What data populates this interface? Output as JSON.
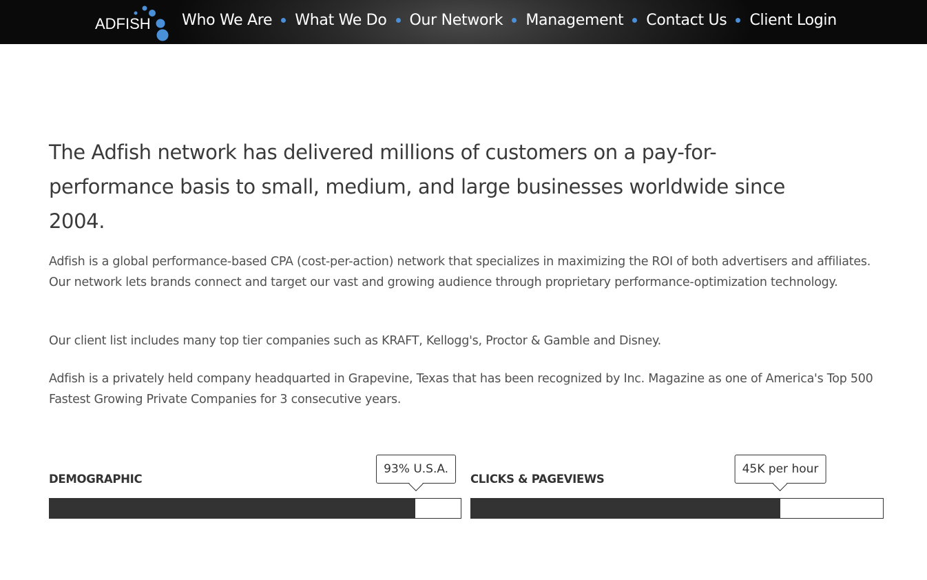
{
  "header": {
    "logo_text": "ADFISH",
    "nav": [
      {
        "label": "Who We Are"
      },
      {
        "label": "What We Do"
      },
      {
        "label": "Our Network"
      },
      {
        "label": "Management"
      },
      {
        "label": "Contact Us"
      },
      {
        "label": "Client Login"
      }
    ]
  },
  "main": {
    "headline": "The Adfish network has delivered millions of customers on a pay-for-performance basis to small, medium, and large businesses worldwide since 2004.",
    "paragraphs": [
      "Adfish is a global performance-based CPA (cost-per-action) network that specializes in maximizing the ROI of both advertisers and affiliates. Our network lets brands connect and target our vast and growing audience through proprietary performance-optimization technology.",
      "Our client list includes many top tier companies such as KRAFT, Kellogg's, Proctor & Gamble and Disney.",
      "Adfish is a privately held company headquarted in Grapevine, Texas that has been recognized by Inc. Magazine as one of America's Top 500 Fastest Growing Private Companies for 3 consecutive years."
    ]
  },
  "stats": [
    {
      "label": "DEMOGRAPHIC",
      "tooltip": "93% U.S.A.",
      "percent": 89
    },
    {
      "label": "CLICKS & PAGEVIEWS",
      "tooltip": "45K per hour",
      "percent": 75
    }
  ],
  "colors": {
    "accent": "#4a90d9",
    "bar_fill": "#333333",
    "header_bg": "#111111"
  }
}
